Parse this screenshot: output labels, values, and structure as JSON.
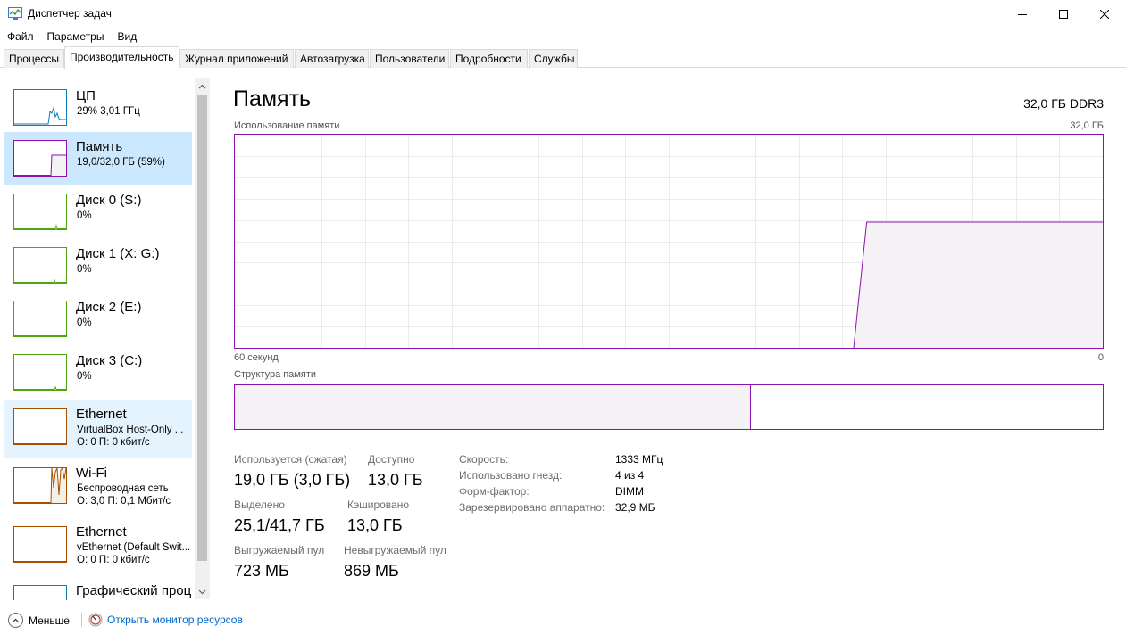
{
  "window": {
    "title": "Диспетчер задач"
  },
  "menu": [
    "Файл",
    "Параметры",
    "Вид"
  ],
  "tabs": [
    {
      "label": "Процессы"
    },
    {
      "label": "Производительность"
    },
    {
      "label": "Журнал приложений"
    },
    {
      "label": "Автозагрузка"
    },
    {
      "label": "Пользователи"
    },
    {
      "label": "Подробности"
    },
    {
      "label": "Службы"
    }
  ],
  "active_tab": "Производительность",
  "sidebar": {
    "items": [
      {
        "title": "ЦП",
        "sub": "29% 3,01 ГГц",
        "sub2": "",
        "color": "#117dbb"
      },
      {
        "title": "Память",
        "sub": "19,0/32,0 ГБ (59%)",
        "sub2": "",
        "color": "#8b12ae"
      },
      {
        "title": "Диск 0 (S:)",
        "sub": "0%",
        "sub2": "",
        "color": "#4da60c"
      },
      {
        "title": "Диск 1 (X: G:)",
        "sub": "0%",
        "sub2": "",
        "color": "#4da60c"
      },
      {
        "title": "Диск 2 (E:)",
        "sub": "0%",
        "sub2": "",
        "color": "#4da60c"
      },
      {
        "title": "Диск 3 (C:)",
        "sub": "0%",
        "sub2": "",
        "color": "#4da60c"
      },
      {
        "title": "Ethernet",
        "sub": "VirtualBox Host-Only ...",
        "sub2": "О: 0 П: 0 кбит/с",
        "color": "#a74f01"
      },
      {
        "title": "Wi-Fi",
        "sub": "Беспроводная сеть",
        "sub2": "О: 3,0 П: 0,1 Мбит/с",
        "color": "#a74f01"
      },
      {
        "title": "Ethernet",
        "sub": "vEthernet (Default Swit...",
        "sub2": "О: 0 П: 0 кбит/с",
        "color": "#a74f01"
      },
      {
        "title": "Графический проц",
        "sub": "",
        "sub2": "",
        "color": "#117dbb"
      }
    ]
  },
  "main": {
    "title": "Память",
    "spec": "32,0 ГБ DDR3",
    "usage_label": "Использование памяти",
    "usage_max": "32,0 ГБ",
    "time_left": "60 секунд",
    "time_right": "0",
    "composition_label": "Структура памяти",
    "composition_used_fraction": 0.595,
    "usage_level_fraction": 0.59,
    "accent_color": "#8b12ae",
    "stats": {
      "in_use_label": "Используется (сжатая)",
      "in_use_value": "19,0 ГБ (3,0 ГБ)",
      "available_label": "Доступно",
      "available_value": "13,0 ГБ",
      "committed_label": "Выделено",
      "committed_value": "25,1/41,7 ГБ",
      "cached_label": "Кэшировано",
      "cached_value": "13,0 ГБ",
      "paged_label": "Выгружаемый пул",
      "paged_value": "723 МБ",
      "nonpaged_label": "Невыгружаемый пул",
      "nonpaged_value": "869 МБ"
    },
    "info": [
      {
        "label": "Скорость:",
        "value": "1333 МГц"
      },
      {
        "label": "Использовано гнезд:",
        "value": "4 из 4"
      },
      {
        "label": "Форм-фактор:",
        "value": "DIMM"
      },
      {
        "label": "Зарезервировано аппаратно:",
        "value": "32,9 МБ"
      }
    ]
  },
  "footer": {
    "less_label": "Меньше",
    "monitor_label": "Открыть монитор ресурсов"
  }
}
